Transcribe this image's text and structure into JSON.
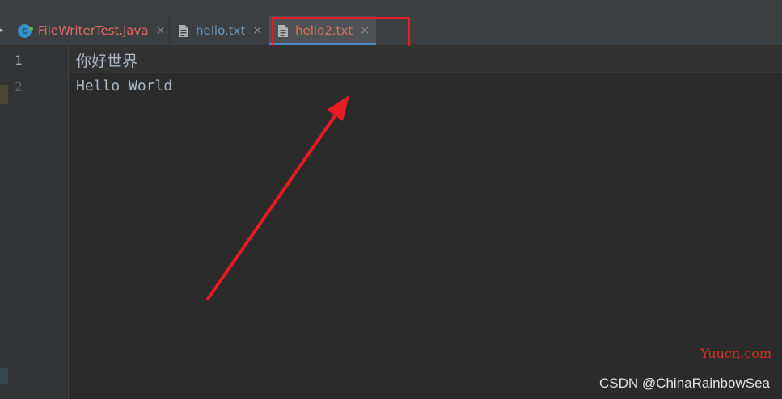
{
  "tabs": [
    {
      "label": "FileWriterTest.java",
      "icon": "java-class-icon",
      "close": "×",
      "label_color": "#e06c63"
    },
    {
      "label": "hello.txt",
      "icon": "text-file-icon",
      "close": "×",
      "label_color": "#6897bb"
    },
    {
      "label": "hello2.txt",
      "icon": "text-file-icon",
      "close": "×",
      "label_color": "#e06c63",
      "active": true
    }
  ],
  "editor": {
    "lines": [
      {
        "number": "1",
        "text": "你好世界"
      },
      {
        "number": "2",
        "text": "Hello World"
      }
    ]
  },
  "annotations": {
    "highlight_color": "#e81b23",
    "arrow_color": "#e81b23"
  },
  "watermarks": {
    "site": "Yuucn.com",
    "author": "CSDN @ChinaRainbowSea"
  },
  "colors": {
    "editor_bg": "#2b2b2b",
    "tabbar_bg": "#3c3f41",
    "active_tab_underline": "#4a88c7",
    "code_text": "#a9b7c6"
  }
}
